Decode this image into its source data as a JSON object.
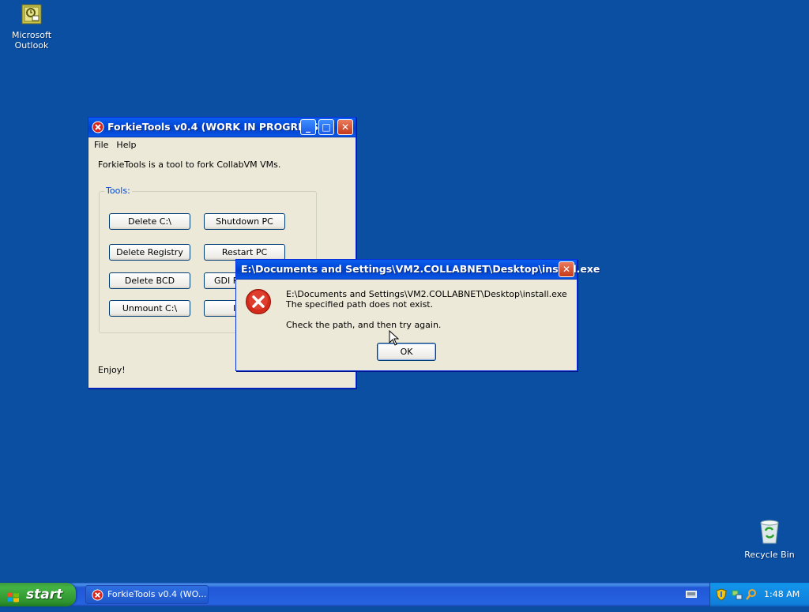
{
  "desktop": {
    "icons": [
      {
        "label_line1": "Microsoft",
        "label_line2": "Outlook",
        "icon": "outlook-icon"
      },
      {
        "label": "Recycle Bin",
        "icon": "recycle-bin-icon"
      }
    ]
  },
  "forkie": {
    "title": "ForkieTools v0.4 (WORK IN PROGRESS)",
    "menu": [
      "File",
      "Help"
    ],
    "description": "ForkieTools is a tool to fork CollabVM VMs.",
    "group_label": "Tools:",
    "buttons": {
      "delete_c": "Delete C:\\",
      "shutdown_pc": "Shutdown PC",
      "delete_registry": "Delete Registry",
      "restart_pc": "Restart PC",
      "delete_bcd": "Delete BCD",
      "gdi": "GDI P",
      "unmount_c": "Unmount C:\\",
      "partial4": "I"
    },
    "footer": "Enjoy!"
  },
  "dialog": {
    "title": "E:\\Documents and Settings\\VM2.COLLABNET\\Desktop\\install.exe",
    "line1": "E:\\Documents and Settings\\VM2.COLLABNET\\Desktop\\install.exe",
    "line2": "The specified path does not exist.",
    "line3": "Check the path, and then try again.",
    "ok_label": "OK"
  },
  "taskbar": {
    "start_label": "start",
    "task_item": "ForkieTools v0.4 (WO...",
    "clock": "1:48 AM"
  },
  "colors": {
    "desktop": "#0b4fa3",
    "titlebar": "#0054e3",
    "window_bg": "#ece9d8",
    "start_green": "#3c9a3c"
  }
}
